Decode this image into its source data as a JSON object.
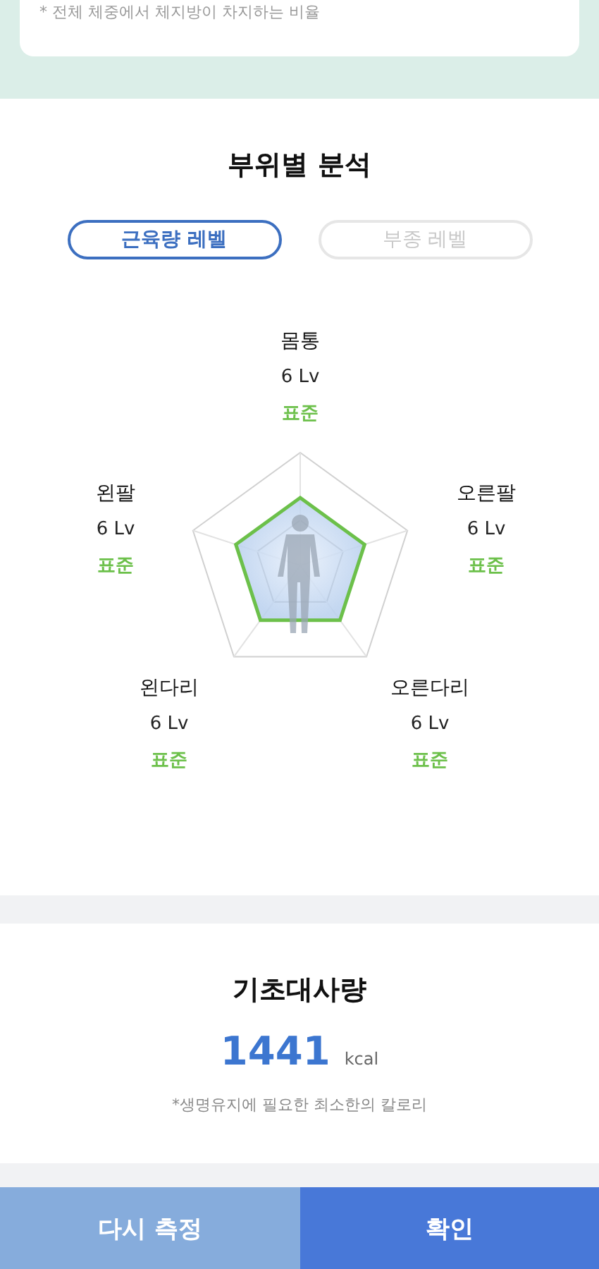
{
  "top_card": {
    "note": "* 전체 체중에서 체지방이 차지하는 비율"
  },
  "segment_analysis": {
    "title": "부위별 분석",
    "tabs": [
      {
        "label": "근육량 레벨",
        "selected": true
      },
      {
        "label": "부종 레벨",
        "selected": false
      }
    ],
    "parts": [
      {
        "name": "몸통",
        "value": "6 Lv",
        "status": "표준"
      },
      {
        "name": "왼팔",
        "value": "6 Lv",
        "status": "표준"
      },
      {
        "name": "오른팔",
        "value": "6 Lv",
        "status": "표준"
      },
      {
        "name": "왼다리",
        "value": "6 Lv",
        "status": "표준"
      },
      {
        "name": "오른다리",
        "value": "6 Lv",
        "status": "표준"
      }
    ]
  },
  "bmr": {
    "title": "기초대사량",
    "value": "1441",
    "unit": "kcal",
    "note": "*생명유지에 필요한 최소한의 칼로리"
  },
  "buttons": [
    {
      "label": "다시 측정",
      "kind": "secondary"
    },
    {
      "label": "확인",
      "kind": "primary"
    }
  ]
}
